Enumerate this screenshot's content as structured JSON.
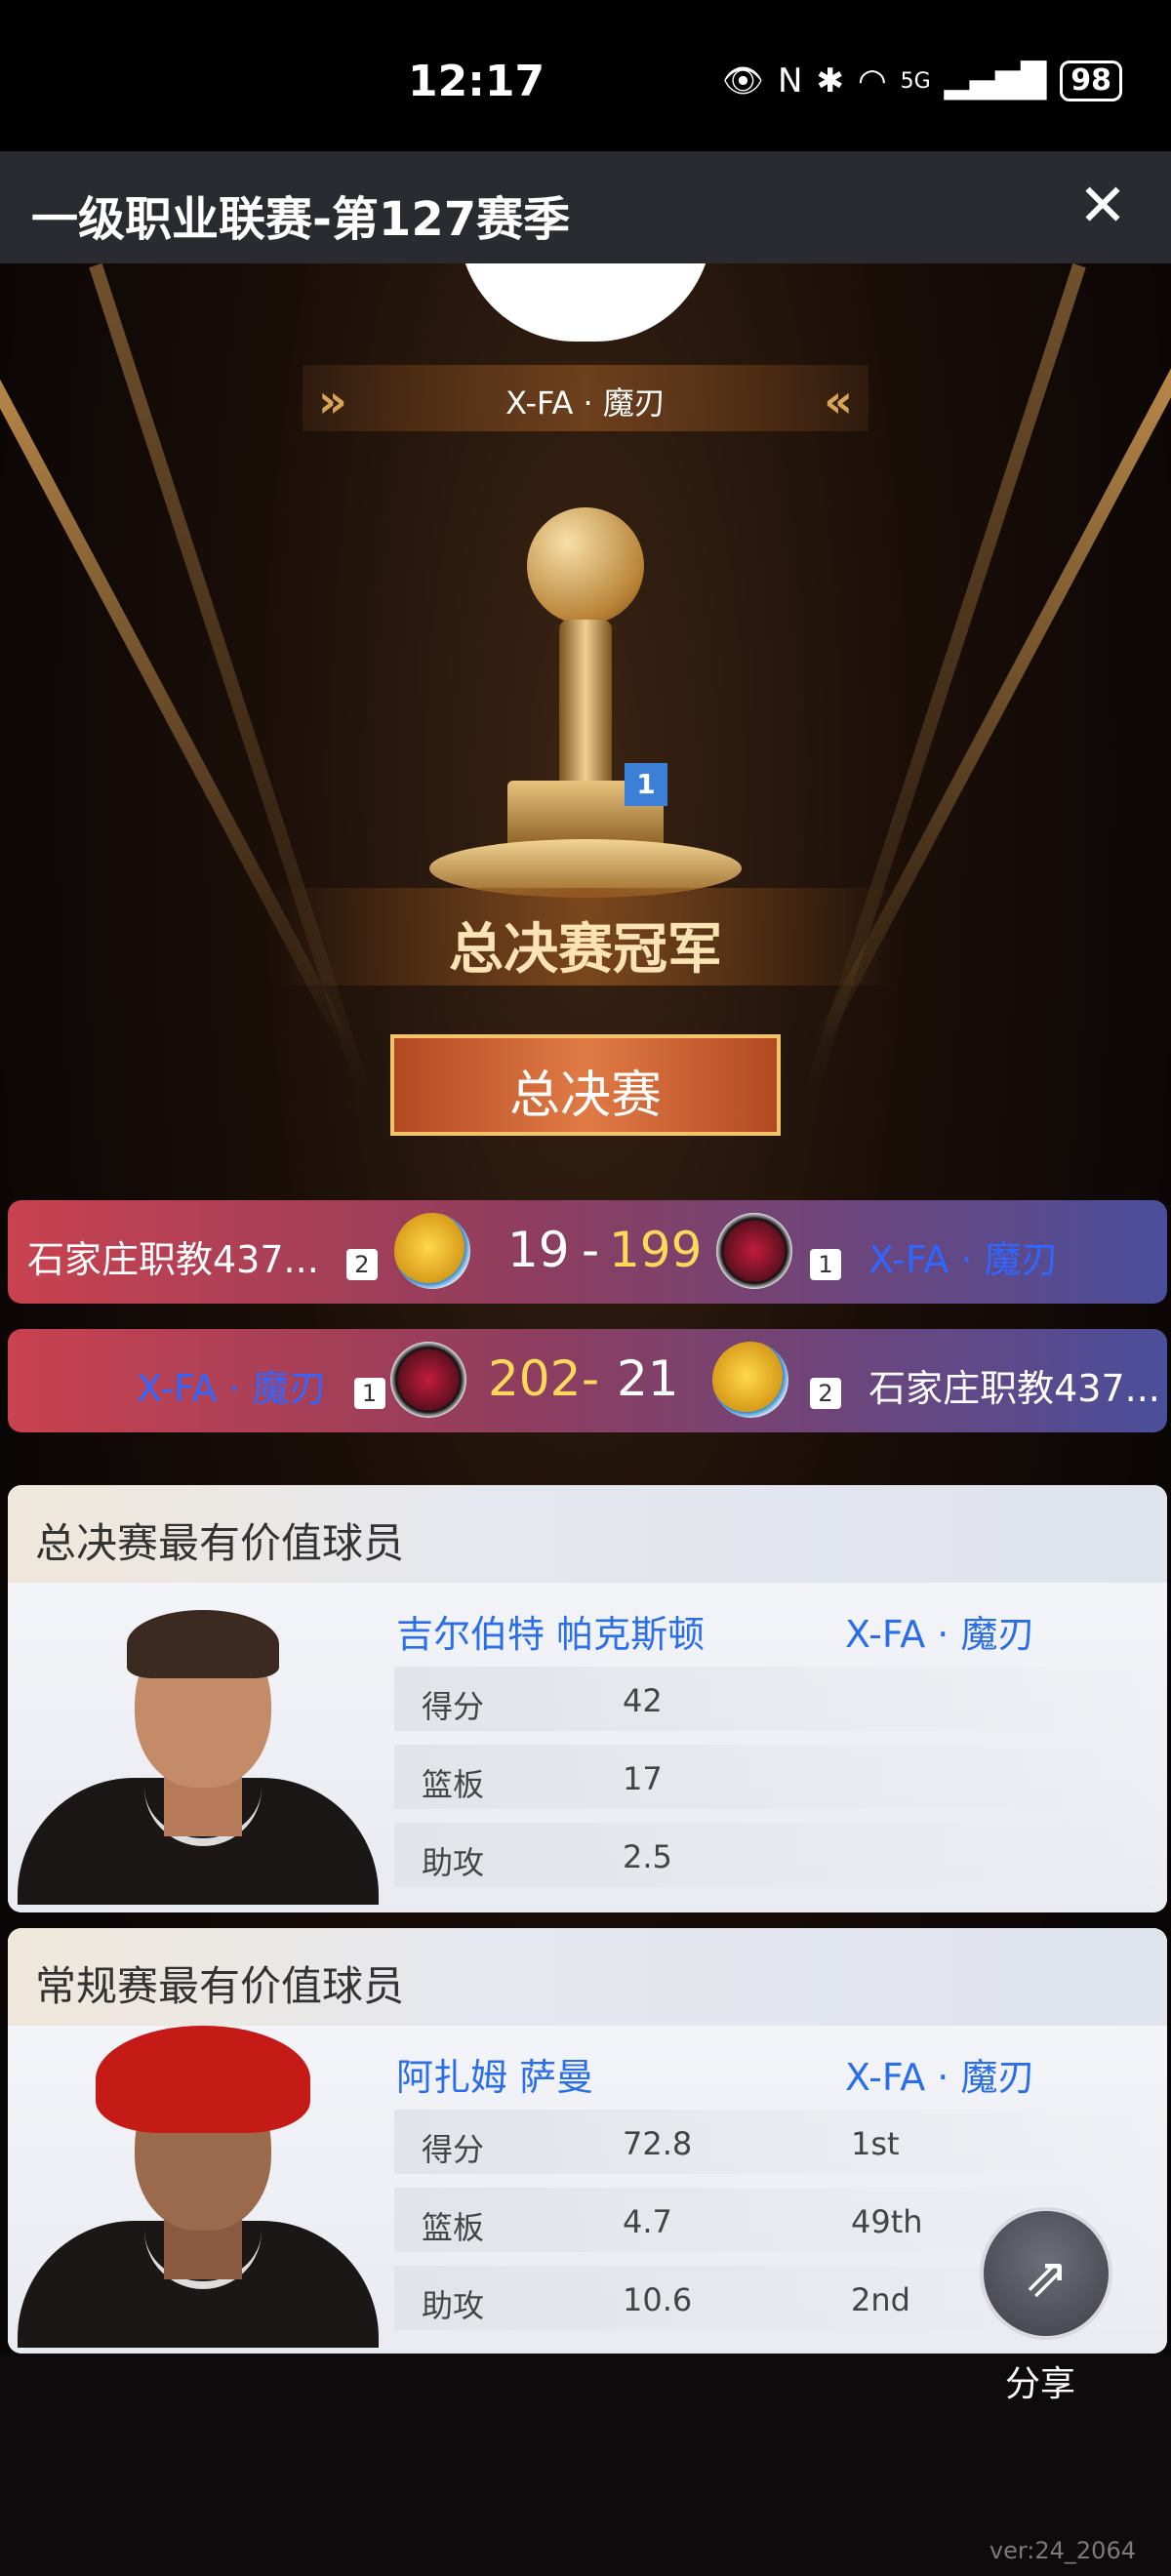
{
  "status": {
    "time": "12:17",
    "battery": "98",
    "network": "5G"
  },
  "header": {
    "title": "一级职业联赛-第127赛季",
    "close_icon": "close-icon"
  },
  "hero": {
    "team_name": "X-FA · 魔刃",
    "trophy_rank": "1",
    "champion_text": "总决赛冠军",
    "round_tag": "总决赛"
  },
  "games": [
    {
      "left_team": "石家庄职教437...",
      "left_rank": "2",
      "left_score": "19",
      "sep": "-",
      "right_score": "199",
      "right_rank": "1",
      "right_team": "X-FA · 魔刃"
    },
    {
      "left_team": "X-FA · 魔刃",
      "left_rank": "1",
      "left_score": "202",
      "sep": "-",
      "right_score": "21",
      "right_rank": "2",
      "right_team": "石家庄职教437..."
    }
  ],
  "finals_mvp": {
    "title": "总决赛最有价值球员",
    "player": "吉尔伯特 帕克斯顿",
    "team": "X-FA · 魔刃",
    "stats": [
      {
        "label": "得分",
        "value": "42"
      },
      {
        "label": "篮板",
        "value": "17"
      },
      {
        "label": "助攻",
        "value": "2.5"
      }
    ]
  },
  "season_mvp": {
    "title": "常规赛最有价值球员",
    "player": "阿扎姆 萨曼",
    "team": "X-FA · 魔刃",
    "stats": [
      {
        "label": "得分",
        "value": "72.8",
        "rank": "1st"
      },
      {
        "label": "篮板",
        "value": "4.7",
        "rank": "49th"
      },
      {
        "label": "助攻",
        "value": "10.6",
        "rank": "2nd"
      }
    ]
  },
  "share": {
    "label": "分享",
    "icon": "share-icon"
  },
  "version": "ver:24_2064",
  "colors": {
    "accent_blue": "#2a6ee8",
    "gold": "#ffd95a",
    "row_red": "#c8424f",
    "row_blue": "#4b4e9a"
  }
}
